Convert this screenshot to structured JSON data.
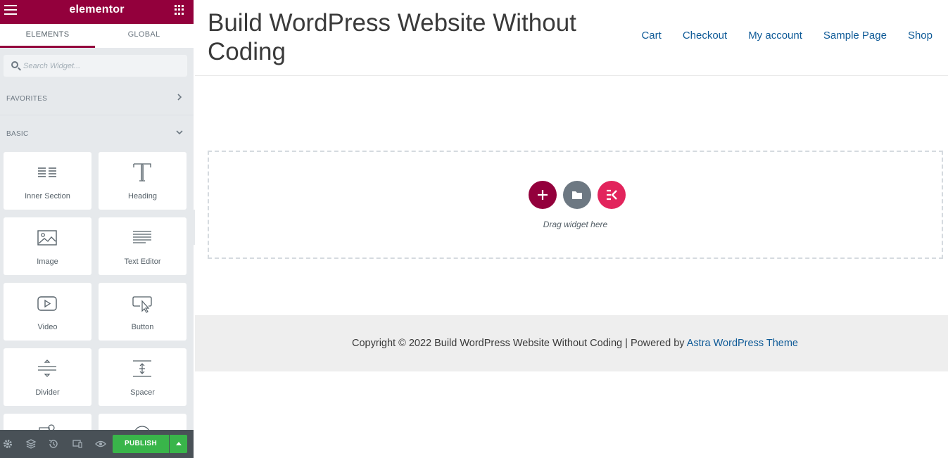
{
  "panel": {
    "logo": "elementor",
    "tabs": [
      {
        "label": "ELEMENTS",
        "active": true
      },
      {
        "label": "GLOBAL",
        "active": false
      }
    ],
    "search": {
      "placeholder": "Search Widget..."
    },
    "categories": {
      "favorites": "FAVORITES",
      "basic": "BASIC"
    },
    "widgets": [
      {
        "label": "Inner Section",
        "icon": "inner-section-icon"
      },
      {
        "label": "Heading",
        "icon": "heading-icon"
      },
      {
        "label": "Image",
        "icon": "image-icon"
      },
      {
        "label": "Text Editor",
        "icon": "text-editor-icon"
      },
      {
        "label": "Video",
        "icon": "video-icon"
      },
      {
        "label": "Button",
        "icon": "button-icon"
      },
      {
        "label": "Divider",
        "icon": "divider-icon"
      },
      {
        "label": "Spacer",
        "icon": "spacer-icon"
      }
    ],
    "footer": {
      "publish_label": "PUBLISH"
    },
    "accent_color": "#93003c",
    "publish_color": "#39b54a"
  },
  "site": {
    "title": "Build WordPress Website Without Coding",
    "nav": [
      "Cart",
      "Checkout",
      "My account",
      "Sample Page",
      "Shop"
    ],
    "drop_zone": {
      "text": "Drag widget here"
    },
    "footer": {
      "copyright": "Copyright © 2022 Build WordPress Website Without Coding | Powered by ",
      "theme_link": "Astra WordPress Theme"
    },
    "link_color": "#0e5a97"
  }
}
